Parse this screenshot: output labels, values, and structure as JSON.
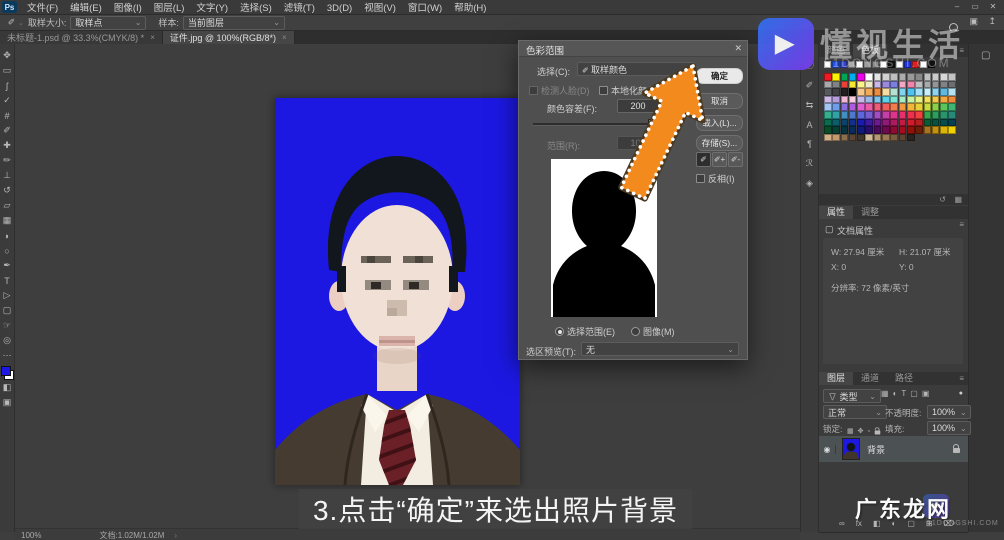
{
  "window": {
    "app_badge": "Ps",
    "menus": [
      {
        "id": "file",
        "label": "文件(F)"
      },
      {
        "id": "edit",
        "label": "编辑(E)"
      },
      {
        "id": "image",
        "label": "图像(I)"
      },
      {
        "id": "layer",
        "label": "图层(L)"
      },
      {
        "id": "type",
        "label": "文字(Y)"
      },
      {
        "id": "select",
        "label": "选择(S)"
      },
      {
        "id": "filter",
        "label": "滤镜(T)"
      },
      {
        "id": "3d",
        "label": "3D(D)"
      },
      {
        "id": "view",
        "label": "视图(V)"
      },
      {
        "id": "window",
        "label": "窗口(W)"
      },
      {
        "id": "help",
        "label": "帮助(H)"
      }
    ],
    "controls": [
      {
        "id": "minimize",
        "glyph": "–"
      },
      {
        "id": "restore",
        "glyph": "▭"
      },
      {
        "id": "close",
        "glyph": "✕"
      }
    ]
  },
  "options_bar": {
    "sample_size_label": "取样大小:",
    "sample_size_value": "取样点",
    "sample_label": "样本:",
    "sample_value": "当前图层"
  },
  "tabs": [
    {
      "id": "untitled",
      "title": "未标题-1.psd @ 33.3%(CMYK/8) *",
      "close": "×",
      "active": false
    },
    {
      "id": "zhengjian",
      "title": "证件.jpg @ 100%(RGB/8*)",
      "close": "×",
      "active": true
    }
  ],
  "toolbar": {
    "tools": [
      {
        "id": "move-tool",
        "glyph": "✥"
      },
      {
        "id": "marquee-tool",
        "glyph": "▭"
      },
      {
        "id": "lasso-tool",
        "glyph": "ʃ"
      },
      {
        "id": "quick-select-tool",
        "glyph": "✓"
      },
      {
        "id": "crop-tool",
        "glyph": "#"
      },
      {
        "id": "eyedropper-tool",
        "glyph": "✐"
      },
      {
        "id": "healing-tool",
        "glyph": "✚"
      },
      {
        "id": "brush-tool",
        "glyph": "✏"
      },
      {
        "id": "stamp-tool",
        "glyph": "⊥"
      },
      {
        "id": "history-brush-tool",
        "glyph": "↺"
      },
      {
        "id": "eraser-tool",
        "glyph": "▱"
      },
      {
        "id": "gradient-tool",
        "glyph": "▦"
      },
      {
        "id": "blur-tool",
        "glyph": "◗"
      },
      {
        "id": "dodge-tool",
        "glyph": "○"
      },
      {
        "id": "pen-tool",
        "glyph": "✒"
      },
      {
        "id": "type-tool",
        "glyph": "T"
      },
      {
        "id": "path-select-tool",
        "glyph": "▷"
      },
      {
        "id": "shape-tool",
        "glyph": "▢"
      },
      {
        "id": "hand-tool",
        "glyph": "☞"
      },
      {
        "id": "zoom-tool",
        "glyph": "◎"
      },
      {
        "id": "more-tools",
        "glyph": "⋯"
      }
    ],
    "foreground_color": "#1c18e2",
    "background_color": "#ffffff",
    "mask_glyph": "◧",
    "screen_glyph": "▣"
  },
  "dialog": {
    "title": "色彩范围",
    "close": "✕",
    "select_label": "选择(C):",
    "select_value": "取样颜色",
    "detect_faces_label": "检测人脸(D)",
    "localized_label": "本地化颜色簇(Z)",
    "fuzziness_label": "颜色容差(F):",
    "fuzziness_value": "200",
    "range_label": "范围(R):",
    "range_value": "100",
    "range_unit": "%",
    "ok": "确定",
    "cancel": "取消",
    "load": "载入(L)...",
    "save": "存储(S)...",
    "invert_label": "反相(I)",
    "selection_radio": "选择范围(E)",
    "image_radio": "图像(M)",
    "preview_label": "选区预览(T):",
    "preview_value": "无",
    "eyedroppers": [
      {
        "id": "sample-eyedropper",
        "mod": ""
      },
      {
        "id": "add-eyedropper",
        "mod": "+"
      },
      {
        "id": "subtract-eyedropper",
        "mod": "-"
      }
    ]
  },
  "arrow": {
    "color": "#f28a1e"
  },
  "photo": {
    "background": "#1c18e2"
  },
  "panels": {
    "top_icons": [
      {
        "id": "search",
        "type": "magnifier"
      },
      {
        "id": "workspace",
        "glyph": "▣"
      },
      {
        "id": "share",
        "glyph": "↥"
      }
    ],
    "quick_icons": [
      {
        "id": "info-panel",
        "glyph": "ⓘ"
      },
      {
        "id": "brush-settings-panel",
        "glyph": "✐"
      },
      {
        "id": "clone-source-panel",
        "glyph": "⇆"
      },
      {
        "id": "character-panel",
        "glyph": "A"
      },
      {
        "id": "paragraph-panel",
        "glyph": "¶"
      },
      {
        "id": "glyphs-panel",
        "glyph": "ℛ"
      },
      {
        "id": "3d-panel",
        "glyph": "◈"
      }
    ],
    "libraries_icon": "▢",
    "swatches": {
      "tab_color": "颜色",
      "tab_swatches": "色板",
      "recent": [
        "#ffffff",
        "#2255ee",
        "#3344cc",
        "#aaaaaa",
        "#ffffff",
        "#999999",
        "#888888",
        "#ffffff",
        "#111111",
        "#ffffff",
        "#2233dd",
        "#dd2222",
        "#ffffff",
        "#111111"
      ],
      "grid": [
        [
          "#ed1c24",
          "#fff200",
          "#00a651",
          "#00aeef",
          "#ec00ec",
          "#ffffff",
          "#e3e3e3",
          "#d1d1d1",
          "#bfbfbf",
          "#acacac",
          "#9a9a9a",
          "#888888",
          "#c0c0c0",
          "#cccccc",
          "#d8d8d8",
          "#c4c4c4"
        ],
        [
          "#a7a9ac",
          "#808285",
          "#e8423a",
          "#f7e733",
          "#fdf38a",
          "#efe8c9",
          "#c9b8e8",
          "#9b8ae0",
          "#7a7fe0",
          "#f2a7c3",
          "#ee85ab",
          "#bcbec0",
          "#a7a9ac",
          "#939598",
          "#808285",
          "#6d6e71"
        ],
        [
          "#58595b",
          "#414042",
          "#231f20",
          "#000000",
          "#f7c789",
          "#f2a95c",
          "#eb8d3f",
          "#f7dca2",
          "#b5e0d2",
          "#7fd4ef",
          "#4fc3ef",
          "#a3e2f5",
          "#c7eefb",
          "#8ed4f0",
          "#5fb9e2",
          "#b3e3f2"
        ],
        [
          "#cdb9e6",
          "#b59ddb",
          "#f2b7d4",
          "#f6cee0",
          "#c7b9e8",
          "#9db9e8",
          "#7fc4ea",
          "#5cd1ea",
          "#7fe3d4",
          "#a3ecc5",
          "#c7f2a3",
          "#e8f283",
          "#f2e05c",
          "#f2c94c",
          "#f2a93f",
          "#ef8a3a"
        ],
        [
          "#a3c7f2",
          "#6d9eea",
          "#8a6de0",
          "#b05ce0",
          "#e05cd1",
          "#ea5ca3",
          "#ef5c7a",
          "#f25c5c",
          "#f27a4c",
          "#f2983f",
          "#f2b53a",
          "#e8cf35",
          "#c7dd3f",
          "#8ccf4c",
          "#5cc45c",
          "#3fb573"
        ],
        [
          "#35ae8e",
          "#2fa3a8",
          "#3f8fc4",
          "#4c7ad1",
          "#5c66dd",
          "#7a5cd1",
          "#a34cc4",
          "#c43fa8",
          "#dd358e",
          "#e82f6d",
          "#ef2f4c",
          "#f23f3f",
          "#35a84c",
          "#2f9e5c",
          "#2a946d",
          "#26897a"
        ],
        [
          "#0b6b4f",
          "#0b5f6b",
          "#0b446b",
          "#122f8e",
          "#1a1aae",
          "#3f1a9e",
          "#6d1a8e",
          "#8e1a7a",
          "#ae1a5f",
          "#c41a44",
          "#d11a2a",
          "#b51f1f",
          "#0e5c35",
          "#0b513f",
          "#094c4c",
          "#083f51"
        ],
        [
          "#0a4c2a",
          "#083f35",
          "#06333f",
          "#0a2a5c",
          "#101a7a",
          "#2a0e6b",
          "#4c0a5c",
          "#6b0a4c",
          "#8e0a35",
          "#a80a1f",
          "#8e1208",
          "#6b1f08",
          "#a8741f",
          "#c4920f",
          "#ddb50a",
          "#f2d100"
        ],
        [
          "#d1b08a",
          "#c49a6d",
          "#8e6d4c",
          "#5c4633",
          "#3f352a",
          "#d1bc9a",
          "#b59a74",
          "#9a7a54",
          "#7a5c3f",
          "#5c442f",
          "#2a2420"
        ]
      ]
    },
    "properties": {
      "tab_properties": "属性",
      "tab_adjust": "调整",
      "doc_label": "文档属性",
      "line_w": "W: 27.94 厘米",
      "line_h": "H: 21.07 厘米",
      "line_x": "X: 0",
      "line_y": "Y: 0",
      "line_res": "分辨率: 72 像素/英寸"
    },
    "layers": {
      "tab_layers": "图层",
      "tab_channels": "通道",
      "tab_paths": "路径",
      "filter_label": "类型",
      "filter_icons": [
        {
          "id": "filter-pixel-layers",
          "glyph": "▦"
        },
        {
          "id": "filter-adjustment-layers",
          "glyph": "◐"
        },
        {
          "id": "filter-type-layers",
          "glyph": "T"
        },
        {
          "id": "filter-shape-layers",
          "glyph": "▢"
        },
        {
          "id": "filter-smart-objects",
          "glyph": "▣"
        }
      ],
      "blend_value": "正常",
      "opacity_label": "不透明度:",
      "opacity_value": "100%",
      "lock_label": "锁定:",
      "lock_icons": [
        {
          "id": "lock-transparency",
          "glyph": "▦"
        },
        {
          "id": "lock-position",
          "glyph": "✥"
        },
        {
          "id": "lock-pixels",
          "glyph": "▫"
        }
      ],
      "fill_label": "填充:",
      "fill_value": "100%",
      "layer_name": "背景",
      "eye_glyph": "◉",
      "bottom_icons": [
        {
          "id": "link-layers",
          "glyph": "∞"
        },
        {
          "id": "layer-styles",
          "glyph": "fx"
        },
        {
          "id": "layer-mask",
          "glyph": "◧"
        },
        {
          "id": "adjustment-layer",
          "glyph": "◐"
        },
        {
          "id": "layer-group",
          "glyph": "▢"
        },
        {
          "id": "new-layer",
          "glyph": "⊞"
        },
        {
          "id": "delete-layer",
          "glyph": "⌦"
        }
      ]
    }
  },
  "status_bar": {
    "zoom": "100%",
    "doc_info": "文档:1.02M/1.02M",
    "caret": "›"
  },
  "watermarks": {
    "brand": "懂视生活",
    "site": "51DONGSHI.COM",
    "corner": "广东龙网"
  },
  "caption": "3.点击“确定”来选出照片背景"
}
